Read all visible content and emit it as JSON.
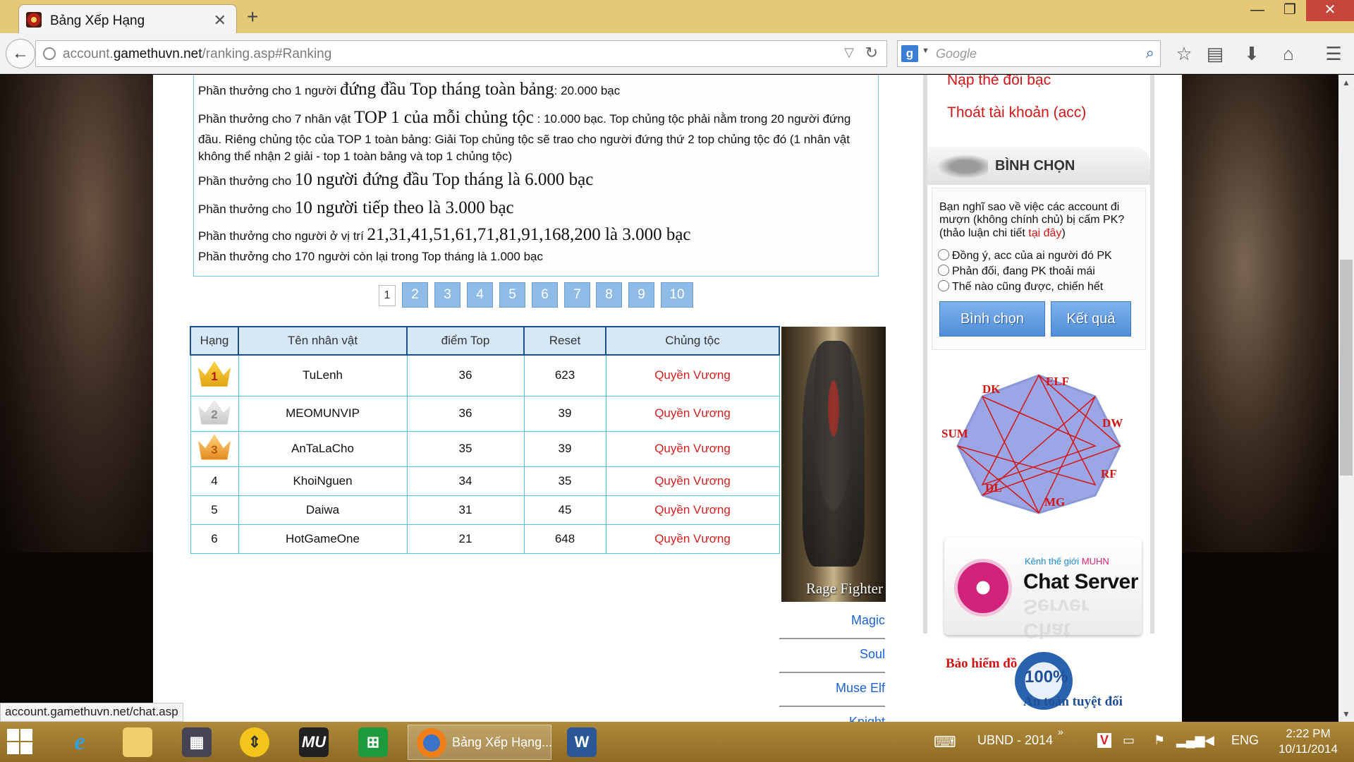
{
  "browser": {
    "tab_title": "Bảng Xếp Hạng",
    "url_prefix": "account.",
    "url_host": "gamethuvn.net",
    "url_path": "/ranking.asp#Ranking",
    "search_placeholder": "Google",
    "search_engine_letter": "g"
  },
  "rewards": {
    "line1_a": "Phần thưởng cho 1 người ",
    "line1_big": "đứng đầu Top tháng toàn bảng",
    "line1_b": ": 20.000 bạc",
    "line2_a": "Phần thưởng cho 7 nhân vật ",
    "line2_big": "TOP 1 của mỗi chủng tộc",
    "line2_b": " : 10.000 bạc. Top chủng tộc phải nằm trong 20 người đứng đầu. Riêng chủng tộc của TOP 1 toàn bảng: Giải Top chủng tộc sẽ trao cho người đứng thứ 2 top chủng tộc đó (1 nhân vật không thể nhận 2 giải - top 1 toàn bảng và top 1 chủng tộc)",
    "line3_a": "Phần thưởng cho ",
    "line3_big": "10 người đứng đầu Top tháng là 6.000 bạc",
    "line4_a": "Phần thưởng cho ",
    "line4_big": "10 người tiếp theo là 3.000 bạc",
    "line5_a": "Phần thưởng cho người ở vị trí ",
    "line5_big": "21,31,41,51,61,71,81,91,168,200 là 3.000 bạc",
    "line6": "Phần thưởng cho 170 người còn lại trong Top tháng là 1.000 bạc"
  },
  "pagination": {
    "current": "1",
    "pages": [
      "2",
      "3",
      "4",
      "5",
      "6",
      "7",
      "8",
      "9",
      "10"
    ]
  },
  "ranking": {
    "headers": [
      "Hạng",
      "Tên nhân vật",
      "điểm Top",
      "Reset",
      "Chủng tộc"
    ],
    "rows": [
      {
        "rank": "1",
        "name": "TuLenh",
        "points": "36",
        "reset": "623",
        "race": "Quyền Vương"
      },
      {
        "rank": "2",
        "name": "MEOMUNVIP",
        "points": "36",
        "reset": "39",
        "race": "Quyền Vương"
      },
      {
        "rank": "3",
        "name": "AnTaLaCho",
        "points": "35",
        "reset": "39",
        "race": "Quyền Vương"
      },
      {
        "rank": "4",
        "name": "KhoiNguen",
        "points": "34",
        "reset": "35",
        "race": "Quyền Vương"
      },
      {
        "rank": "5",
        "name": "Daiwa",
        "points": "31",
        "reset": "45",
        "race": "Quyền Vương"
      },
      {
        "rank": "6",
        "name": "HotGameOne",
        "points": "21",
        "reset": "648",
        "race": "Quyền Vương"
      }
    ]
  },
  "class_panel": {
    "image_caption": "Rage Fighter",
    "links": [
      "Magic",
      "Soul",
      "Muse Elf",
      "Knight"
    ]
  },
  "sidebar": {
    "link_topup": "Nạp thẻ đổi bạc",
    "link_logout": "Thoát tài khoản (acc)",
    "poll_title": "BÌNH CHỌN",
    "poll_question": "Bạn nghĩ sao về việc các account đi mượn (không chính chủ) bị cấm PK? (thảo luận chi tiết ",
    "poll_question_link": "tại đây",
    "poll_question_end": ")",
    "poll_options": [
      "Đồng ý, acc của ai người đó PK",
      "Phản đối, đang PK thoải mái",
      "Thế nào cũng được, chiến hết"
    ],
    "vote_button": "Bình chọn",
    "result_button": "Kết quả",
    "race_labels": [
      "DK",
      "ELF",
      "DW",
      "RF",
      "MG",
      "DL",
      "SUM"
    ],
    "chat_small_a": "Kênh thế giới ",
    "chat_small_b": "MUHN",
    "chat_big": "Chat Server",
    "insure_t1": "Bảo hiểm đồ",
    "insure_pct": "100%",
    "insure_t2": "An toàn tuyệt đối"
  },
  "status_url": "account.gamethuvn.net/chat.asp",
  "taskbar": {
    "firefox_label": "Bảng Xếp Hạng...",
    "tray_text": "UBND - 2014",
    "lang": "ENG",
    "time": "2:22 PM",
    "date": "10/11/2014"
  },
  "colors": {
    "accent_red": "#d71f1f",
    "table_header_bg": "#d6e8f7",
    "pager_blue": "#8fbbe7",
    "link_blue": "#1b63d6"
  }
}
